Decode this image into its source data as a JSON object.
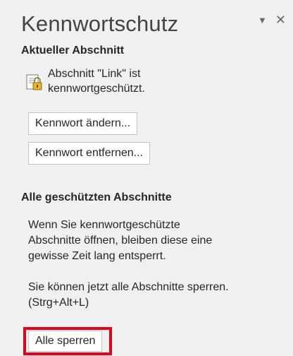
{
  "pane": {
    "title": "Kennwortschutz",
    "controls": {
      "options_icon": "chevron-down-icon",
      "close_icon": "close-icon"
    }
  },
  "current_section": {
    "heading": "Aktueller Abschnitt",
    "status_line1": "Abschnitt \"Link\" ist",
    "status_line2": "kennwortgeschützt.",
    "status_icon": "lock-section-icon",
    "change_button": "Kennwort ändern...",
    "remove_button": "Kennwort entfernen..."
  },
  "all_sections": {
    "heading": "Alle geschützten Abschnitte",
    "info_line1": "Wenn Sie kennwortgeschützte",
    "info_line2": "Abschnitte öffnen, bleiben diese eine",
    "info_line3": "gewisse Zeit lang entsperrt.",
    "lock_hint_line1": "Sie können jetzt alle Abschnitte sperren.",
    "lock_hint_line2": "(Strg+Alt+L)",
    "lock_all_button": "Alle sperren"
  },
  "colors": {
    "highlight": "#e3001b",
    "background": "#f0f0f0"
  }
}
